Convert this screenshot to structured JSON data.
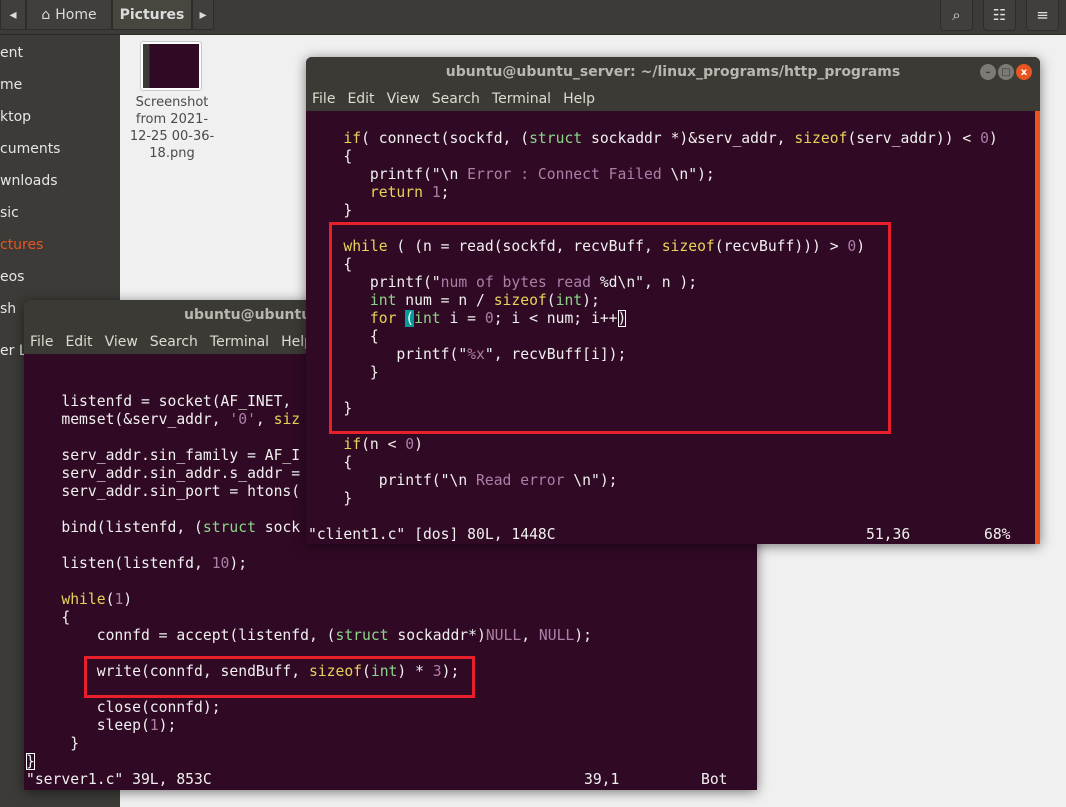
{
  "header": {
    "home": "Home",
    "pictures": "Pictures",
    "icons": [
      "back-arrow",
      "home-icon",
      "forward-arrow",
      "search-icon",
      "view-toggle-icon",
      "hamburger-menu-icon"
    ]
  },
  "sidebar": {
    "items": [
      {
        "label": "ent"
      },
      {
        "label": "me"
      },
      {
        "label": "ktop"
      },
      {
        "label": "cuments"
      },
      {
        "label": "wnloads"
      },
      {
        "label": "sic"
      },
      {
        "label": "ctures",
        "selected": true
      },
      {
        "label": "eos"
      },
      {
        "label": "sh"
      },
      {
        "label": "er L"
      }
    ]
  },
  "files": [
    {
      "name": "Screenshot from 2021-12-25 00-36-18.png"
    }
  ],
  "client": {
    "title": "ubuntu@ubuntu_server: ~/linux_programs/http_programs",
    "menu": [
      "File",
      "Edit",
      "View",
      "Search",
      "Terminal",
      "Help"
    ],
    "lines": [
      [],
      [
        [
          "    "
        ],
        [
          "if",
          "k"
        ],
        [
          "( connect(sockfd, ("
        ],
        [
          "struct",
          "t"
        ],
        [
          " sockaddr *)&serv_addr, "
        ],
        [
          "sizeof",
          "k"
        ],
        [
          "(serv_addr)) < "
        ],
        [
          "0",
          "n"
        ],
        [
          ")"
        ]
      ],
      [
        [
          "    {"
        ]
      ],
      [
        [
          "       printf(\"\\n "
        ],
        [
          "Error : Connect Failed",
          "s"
        ],
        [
          " \\n\");"
        ]
      ],
      [
        [
          "       "
        ],
        [
          "return",
          "k"
        ],
        [
          " "
        ],
        [
          "1",
          "n"
        ],
        [
          ";"
        ]
      ],
      [
        [
          "    }"
        ]
      ],
      [],
      [
        [
          "    "
        ],
        [
          "while",
          "k"
        ],
        [
          " ( (n = read(sockfd, recvBuff, "
        ],
        [
          "sizeof",
          "k"
        ],
        [
          "(recvBuff))) > "
        ],
        [
          "0",
          "n"
        ],
        [
          ")"
        ]
      ],
      [
        [
          "    {"
        ]
      ],
      [
        [
          "       printf(\""
        ],
        [
          "num of bytes read ",
          "s"
        ],
        [
          "%d\\n\", n );"
        ]
      ],
      [
        [
          "       "
        ],
        [
          "int",
          "t"
        ],
        [
          " num = n / "
        ],
        [
          "sizeof",
          "k"
        ],
        [
          "("
        ],
        [
          "int",
          "t"
        ],
        [
          ");"
        ]
      ],
      [
        [
          "       "
        ],
        [
          "for",
          "k"
        ],
        [
          " "
        ],
        [
          "(",
          "cur"
        ],
        [
          "int",
          "t"
        ],
        [
          " i = "
        ],
        [
          "0",
          "n"
        ],
        [
          "; i < num; i++"
        ],
        [
          ")",
          "curbox"
        ]
      ],
      [
        [
          "       {"
        ]
      ],
      [
        [
          "          printf(\""
        ],
        [
          "%x",
          "s"
        ],
        [
          "\", recvBuff[i]);"
        ]
      ],
      [
        [
          "       }"
        ]
      ],
      [],
      [
        [
          "    }"
        ]
      ],
      [],
      [
        [
          "    "
        ],
        [
          "if",
          "k"
        ],
        [
          "(n < "
        ],
        [
          "0",
          "n"
        ],
        [
          ")"
        ]
      ],
      [
        [
          "    {"
        ]
      ],
      [
        [
          "        printf(\"\\n "
        ],
        [
          "Read error",
          "s"
        ],
        [
          " \\n\");"
        ]
      ],
      [
        [
          "    }"
        ]
      ],
      []
    ],
    "status": {
      "file": "\"client1.c\" [dos] 80L, 1448C",
      "pos": "51,36",
      "percent": "68%"
    }
  },
  "server": {
    "title": "ubuntu@ubuntu_",
    "menu": [
      "File",
      "Edit",
      "View",
      "Search",
      "Terminal",
      "Help"
    ],
    "lines": [
      [],
      [],
      [
        [
          "    listenfd = socket(AF_INET,"
        ]
      ],
      [
        [
          "    memset(&serv_addr, "
        ],
        [
          "'0'",
          "s"
        ],
        [
          ", "
        ],
        [
          "siz",
          "k"
        ]
      ],
      [],
      [
        [
          "    serv_addr.sin_family = AF_I"
        ]
      ],
      [
        [
          "    serv_addr.sin_addr.s_addr ="
        ]
      ],
      [
        [
          "    serv_addr.sin_port = htons("
        ]
      ],
      [],
      [
        [
          "    bind(listenfd, ("
        ],
        [
          "struct",
          "t"
        ],
        [
          " sock"
        ]
      ],
      [],
      [
        [
          "    listen(listenfd, "
        ],
        [
          "10",
          "n"
        ],
        [
          ");"
        ]
      ],
      [],
      [
        [
          "    "
        ],
        [
          "while",
          "k"
        ],
        [
          "("
        ],
        [
          "1",
          "n"
        ],
        [
          ")"
        ]
      ],
      [
        [
          "    {"
        ]
      ],
      [
        [
          "        connfd = accept(listenfd, ("
        ],
        [
          "struct",
          "t"
        ],
        [
          " sockaddr*)"
        ],
        [
          "NULL",
          "n"
        ],
        [
          ", "
        ],
        [
          "NULL",
          "n"
        ],
        [
          ");"
        ]
      ],
      [],
      [
        [
          "        write(connfd, sendBuff, "
        ],
        [
          "sizeof",
          "k"
        ],
        [
          "("
        ],
        [
          "int",
          "t"
        ],
        [
          ") * "
        ],
        [
          "3",
          "n"
        ],
        [
          ");"
        ]
      ],
      [],
      [
        [
          "        close(connfd);"
        ]
      ],
      [
        [
          "        sleep("
        ],
        [
          "1",
          "n"
        ],
        [
          ");"
        ]
      ],
      [
        [
          "     }"
        ]
      ],
      [
        [
          "}",
          "curbox"
        ]
      ]
    ],
    "status": {
      "file": "\"server1.c\" 39L, 853C",
      "pos": "39,1",
      "percent": "Bot"
    }
  },
  "colors": {
    "terminal_bg": "#300a24",
    "keyword": "#e6d45a",
    "type": "#8bd58b",
    "literal": "#ad7fa8",
    "highlight_box": "#e8202a",
    "accent": "#e95420"
  }
}
